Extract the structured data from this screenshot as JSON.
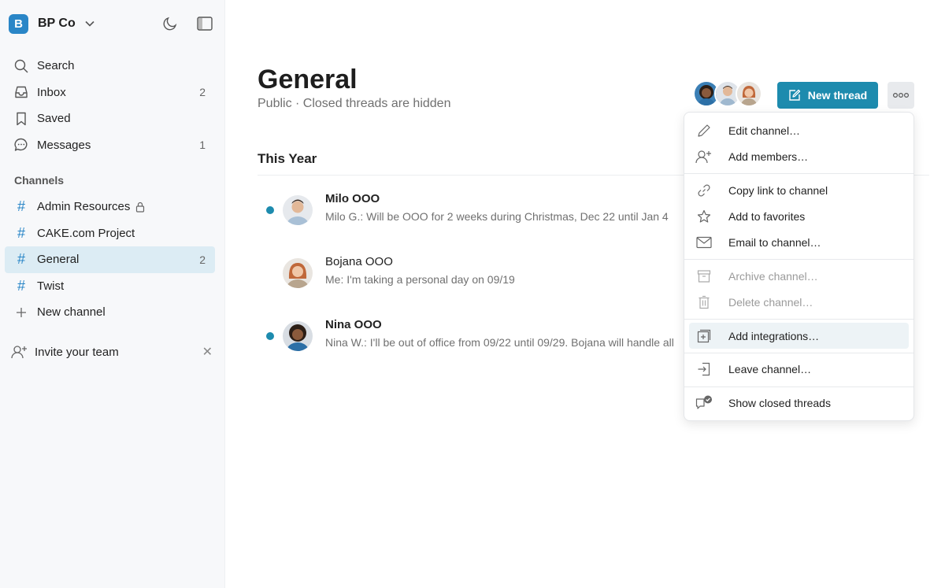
{
  "workspace": {
    "initial": "B",
    "name": "BP Co"
  },
  "nav": {
    "search": "Search",
    "inbox": "Inbox",
    "inbox_count": "2",
    "saved": "Saved",
    "messages": "Messages",
    "messages_count": "1"
  },
  "channels_label": "Channels",
  "channels": [
    {
      "name": "Admin Resources",
      "locked": true,
      "count": ""
    },
    {
      "name": "CAKE.com Project",
      "locked": false,
      "count": ""
    },
    {
      "name": "General",
      "locked": false,
      "count": "2",
      "active": true
    },
    {
      "name": "Twist",
      "locked": false,
      "count": ""
    }
  ],
  "new_channel": "New channel",
  "invite_team": "Invite your team",
  "channel": {
    "title": "General",
    "subtitle": "Public · Closed threads are hidden",
    "new_thread_label": "New thread"
  },
  "section_title": "This Year",
  "threads": [
    {
      "title": "Milo OOO",
      "unread": true,
      "preview": "Milo G.: Will be OOO for 2 weeks during Christmas, Dec 22 until Jan 4"
    },
    {
      "title": "Bojana OOO",
      "unread": false,
      "preview": "Me: I'm taking a personal day on 09/19"
    },
    {
      "title": "Nina OOO",
      "unread": true,
      "preview": "Nina W.: I'll be out of office from 09/22 until 09/29. Bojana will handle all"
    }
  ],
  "menu": {
    "edit_channel": "Edit channel…",
    "add_members": "Add members…",
    "copy_link": "Copy link to channel",
    "add_favorites": "Add to favorites",
    "email_channel": "Email to channel…",
    "archive_channel": "Archive channel…",
    "delete_channel": "Delete channel…",
    "add_integrations": "Add integrations…",
    "leave_channel": "Leave channel…",
    "show_closed": "Show closed threads"
  },
  "colors": {
    "accent": "#1d8bae",
    "workspace_badge": "#2a86c7",
    "active_nav": "#dcecf4"
  }
}
